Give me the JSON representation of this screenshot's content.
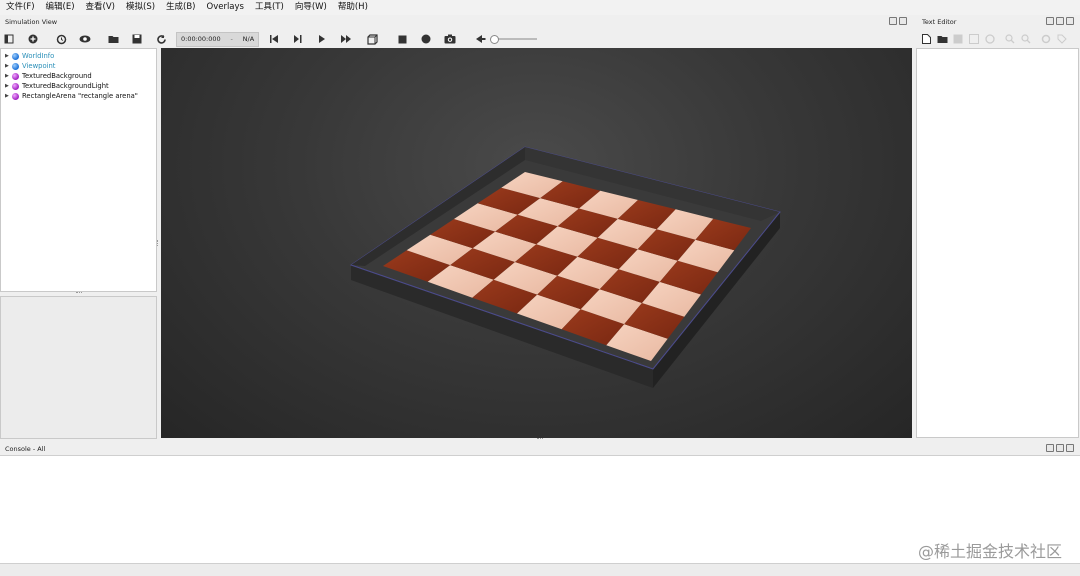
{
  "menu": [
    "文件(F)",
    "编辑(E)",
    "查看(V)",
    "模拟(S)",
    "生成(B)",
    "Overlays",
    "工具(T)",
    "向导(W)",
    "帮助(H)"
  ],
  "panels": {
    "simulation_view_title": "Simulation View",
    "text_editor_title": "Text Editor",
    "console_title": "Console - All"
  },
  "toolbar": {
    "time": "0:00:00:000",
    "time_separator": "-",
    "fps": "N/A",
    "icons": [
      "toggle-tree-icon",
      "add-node-icon",
      "rewind-world-icon",
      "view-icon",
      "open-world-icon",
      "save-world-icon",
      "reload-world-icon",
      "reset-icon",
      "step-icon",
      "play-icon",
      "fast-forward-icon",
      "cube-icon",
      "stop-record-icon",
      "record-icon",
      "screenshot-icon",
      "audio-icon"
    ]
  },
  "scene_tree": [
    {
      "label": "WorldInfo",
      "color": "blue",
      "link": true
    },
    {
      "label": "Viewpoint",
      "color": "blue",
      "link": true
    },
    {
      "label": "TexturedBackground",
      "color": "purple",
      "link": false
    },
    {
      "label": "TexturedBackgroundLight",
      "color": "purple",
      "link": false
    },
    {
      "label": "RectangleArena \"rectangle arena\"",
      "color": "purple",
      "link": false
    }
  ],
  "arena": {
    "floor_dark": "#8a3218",
    "floor_light": "#f2c8b4",
    "wall_color": "#3a3a3a",
    "grid": 6
  },
  "watermark": "@稀土掘金技术社区"
}
